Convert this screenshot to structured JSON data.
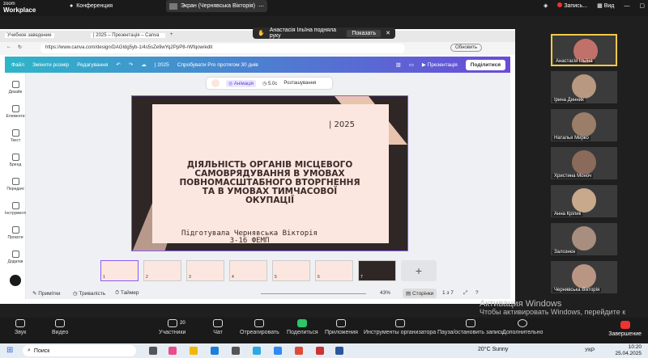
{
  "zoom": {
    "brand": "zoom",
    "brand_sub": "Workplace",
    "meeting": "Конференция",
    "screen_chip": "Экран (Чернявська Вікторія)",
    "recording": "Запись...",
    "view": "Вид"
  },
  "raise_hand": {
    "text": "Анастасія Ільїна подняла руку",
    "button": "Показать"
  },
  "browser": {
    "tab1": "Учебное заведение",
    "tab2": "| 2025 – Презентація – Canva",
    "url": "https://www.canva.com/design/DAGIdg5yb-1/4s5sZe9wYq2PpP8-rWfqow/edit",
    "update": "Обновить"
  },
  "canva": {
    "file": "Файл",
    "resize": "Змінити розмір",
    "editing": "Редагування",
    "doc_title": "| 2025",
    "pro": "Спробувати Pro протягом 30 днів",
    "present": "Презентація",
    "share": "Поділитися",
    "sidebar": [
      "Дизайн",
      "Елементи",
      "Текст",
      "Бренд",
      "Передачі",
      "Інструменти",
      "Проєкти",
      "Додатки"
    ],
    "toolbar": {
      "animation": "Анімація",
      "duration": "5.0с",
      "position": "Розташування"
    },
    "slide": {
      "year": "| 2025",
      "title": "ДІЯЛЬНІСТЬ ОРГАНІВ МІСЦЕВОГО САМОВРЯДУВАННЯ В УМОВАХ ПОВНОМАСШТАБНОГО ВТОРГНЕННЯ ТА В УМОВАХ ТИМЧАСОВОЇ ОКУПАЦІЇ",
      "author": "Підготувала Чернявська Вікторія 3-16 ФЕМП"
    },
    "thumbs": [
      "1",
      "2",
      "3",
      "4",
      "5",
      "6",
      "7"
    ],
    "bottom": {
      "notes": "Примітки",
      "duration": "Тривалість",
      "timer": "Таймер",
      "zoom": "43%",
      "pages": "Сторінки",
      "count": "1 з 7"
    }
  },
  "participants": [
    {
      "name": "Анастасія Ільїна"
    },
    {
      "name": "Ірина Динник"
    },
    {
      "name": "Наталья Мирко"
    },
    {
      "name": "Христина Моноч"
    },
    {
      "name": "Анна Крілик"
    },
    {
      "name": "Залознєн"
    },
    {
      "name": "Чернявська Вікторія"
    }
  ],
  "watermark": {
    "line1": "Активация Windows",
    "line2": "Чтобы активировать Windows, перейдите к разделу параметров"
  },
  "controls": {
    "audio": "Звук",
    "video": "Видео",
    "participants": "Участники",
    "participants_count": "20",
    "chat": "Чат",
    "react": "Отреагировать",
    "share": "Поделиться",
    "apps": "Приложения",
    "organizer": "Инструменты организатора",
    "pause": "Пауза/остановить запись",
    "more": "Дополнительно",
    "end": "Завершение"
  },
  "taskbar": {
    "search": "Поиск",
    "weather": "20°C  Sunny",
    "lang": "УКР",
    "time": "10:20",
    "date": "25.04.2025"
  }
}
